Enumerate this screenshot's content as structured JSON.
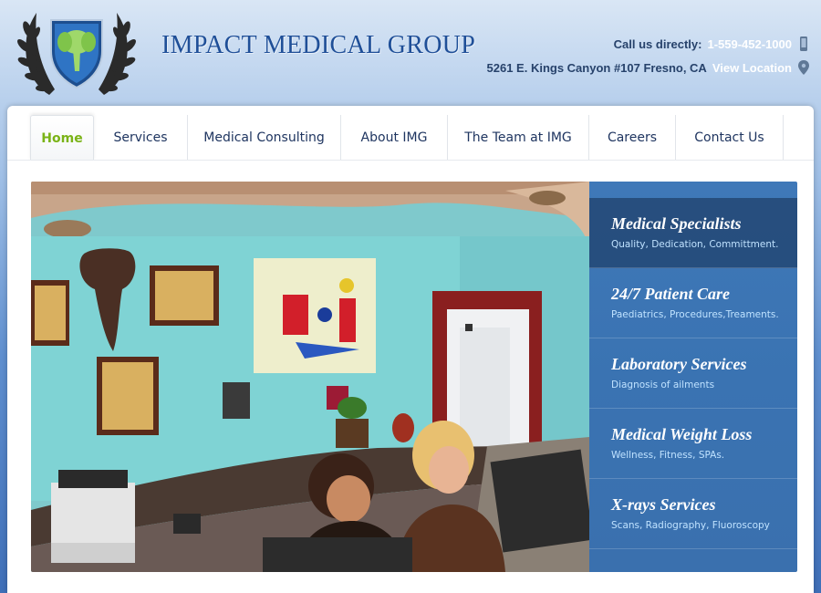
{
  "brand": {
    "name": "IMPACT MEDICAL GROUP",
    "logo_icon": "elephant-shield-laurel-icon"
  },
  "contact": {
    "call_label": "Call us directly:",
    "phone": "1-559-452-1000",
    "phone_icon": "mobile-phone-icon",
    "address": "5261 E. Kings Canyon #107 Fresno, CA",
    "location_link": "View Location",
    "location_icon": "map-pin-icon"
  },
  "nav": {
    "items": [
      {
        "label": "Home",
        "active": true
      },
      {
        "label": "Services"
      },
      {
        "label": "Medical Consulting"
      },
      {
        "label": "About IMG"
      },
      {
        "label": "The Team at IMG"
      },
      {
        "label": "Careers"
      },
      {
        "label": "Contact Us"
      }
    ]
  },
  "slider": {
    "photo_alt": "medical-office-reception-photo",
    "items": [
      {
        "title": "Medical Specialists",
        "subtitle": "Quality, Dedication, Committment.",
        "active": true
      },
      {
        "title": "24/7 Patient Care",
        "subtitle": "Paediatrics, Procedures,Treaments."
      },
      {
        "title": "Laboratory Services",
        "subtitle": "Diagnosis of ailments"
      },
      {
        "title": "Medical Weight Loss",
        "subtitle": "Wellness, Fitness, SPAs."
      },
      {
        "title": "X-rays Services",
        "subtitle": "Scans, Radiography, Fluoroscopy"
      }
    ]
  },
  "colors": {
    "brand_blue": "#1f4f98",
    "nav_active": "#7ab317",
    "sidebar_blue": "#3a73b2",
    "sidebar_sub": "#bfe2ff"
  }
}
